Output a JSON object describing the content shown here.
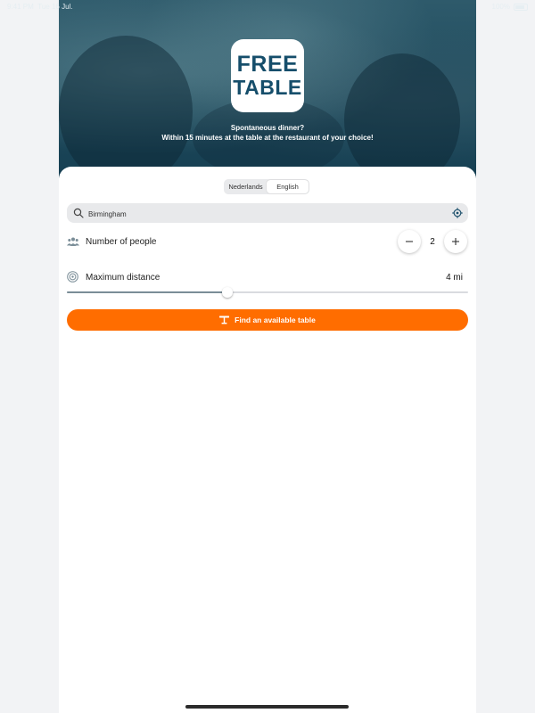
{
  "status_bar": {
    "time": "9:41 PM",
    "date": "Tue 16 Jul.",
    "battery": "100%"
  },
  "hero": {
    "logo_line1": "FREE",
    "logo_line2": "TABLE",
    "tagline1": "Spontaneous dinner?",
    "tagline2": "Within 15 minutes at the table at the restaurant of your choice!"
  },
  "language": {
    "options": [
      "Nederlands",
      "English"
    ],
    "selected": "English"
  },
  "search": {
    "value": "Birmingham",
    "placeholder": "",
    "icon": "search-icon",
    "location_icon": "location-target-icon"
  },
  "people": {
    "label": "Number of people",
    "value": "2",
    "icon": "people-icon",
    "minus_icon": "minus-icon",
    "plus_icon": "plus-icon"
  },
  "distance": {
    "label": "Maximum distance",
    "value": "4 mi",
    "slider_fraction": 0.4,
    "icon": "radius-icon"
  },
  "cta": {
    "label": "Find an available table",
    "icon": "table-icon",
    "color": "#ff6d00"
  },
  "colors": {
    "accent": "#ff6d00",
    "brand": "#164e6b",
    "hero_bg": "#1f4b5d"
  }
}
